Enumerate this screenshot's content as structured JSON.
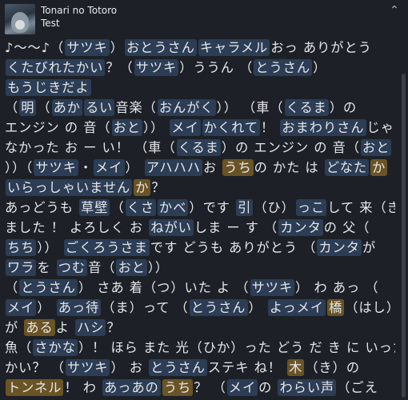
{
  "song": {
    "title": "Tonari no Totoro",
    "subtitle": "Test"
  },
  "icons": {
    "collapse": "chevron-up-icon"
  },
  "colors": {
    "word_highlight": "#2c3d55",
    "active_highlight": "#6a5425",
    "background": "#1d2127"
  },
  "lyrics": [
    [
      [
        "♪〜〜♪（",
        ""
      ],
      [
        "サツキ",
        "w"
      ],
      [
        "）",
        ""
      ],
      [
        "おとうさん",
        "w"
      ],
      [
        "キャラメル",
        "w"
      ],
      [
        "おっ ありがとう",
        ""
      ]
    ],
    [
      [
        "くたびれたかい",
        "w"
      ],
      [
        "？（",
        ""
      ],
      [
        "サツキ",
        "w"
      ],
      [
        "）ううん （",
        ""
      ],
      [
        "とうさん",
        "w"
      ],
      [
        "）",
        ""
      ]
    ],
    [
      [
        "もうじきだよ",
        "w"
      ]
    ],
    [
      [
        "（",
        ""
      ],
      [
        "明",
        "w"
      ],
      [
        "（",
        ""
      ],
      [
        "あか",
        "w"
      ],
      [
        "るい",
        "w"
      ],
      [
        "音楽（",
        ""
      ],
      [
        "おんがく",
        "w"
      ],
      [
        "）） （",
        ""
      ],
      [
        "車",
        ""
      ],
      [
        "（",
        ""
      ],
      [
        "くるま",
        "w"
      ],
      [
        "）の",
        ""
      ]
    ],
    [
      [
        "エンジン の 音（",
        ""
      ],
      [
        "おと",
        "w"
      ],
      [
        "）） ",
        ""
      ],
      [
        "メイ",
        "w"
      ],
      [
        "かくれて",
        "w"
      ],
      [
        "！ ",
        ""
      ],
      [
        "おまわりさん",
        "w"
      ],
      [
        "じゃ",
        ""
      ]
    ],
    [
      [
        "なかった お ー い！ （車（",
        ""
      ],
      [
        "くるま",
        "w"
      ],
      [
        "）の エンジン の 音（",
        ""
      ],
      [
        "おと",
        "w"
      ]
    ],
    [
      [
        "））（",
        ""
      ],
      [
        "サツキ",
        "w"
      ],
      [
        "・",
        ""
      ],
      [
        "メイ",
        "w"
      ],
      [
        "） ",
        ""
      ],
      [
        "アハハハ",
        "w"
      ],
      [
        "お ",
        ""
      ],
      [
        "うち",
        "y"
      ],
      [
        "の かた は ",
        ""
      ],
      [
        "どなた",
        "w"
      ],
      [
        "か",
        "y"
      ]
    ],
    [
      [
        "いらっしゃいません",
        "w"
      ],
      [
        "か",
        "y"
      ],
      [
        "？",
        ""
      ]
    ],
    [
      [
        "あっどうも ",
        ""
      ],
      [
        "草壁",
        "w"
      ],
      [
        "（",
        ""
      ],
      [
        "くさ",
        "w"
      ],
      [
        "かべ",
        "w"
      ],
      [
        "）です ",
        ""
      ],
      [
        "引",
        "w"
      ],
      [
        "（ひ）",
        ""
      ],
      [
        "っこ",
        "w"
      ],
      [
        "して 来（き）",
        ""
      ]
    ],
    [
      [
        "ました ！ よろしく お ",
        ""
      ],
      [
        "ねがい",
        "w"
      ],
      [
        "しま ー す （",
        ""
      ],
      [
        "カンタ",
        "w"
      ],
      [
        "の 父（",
        ""
      ]
    ],
    [
      [
        "ちち",
        "w"
      ],
      [
        "）） ",
        ""
      ],
      [
        "ごくろうさま",
        "w"
      ],
      [
        "です どうも ありがとう （",
        ""
      ],
      [
        "カンタ",
        "w"
      ],
      [
        "が",
        ""
      ]
    ],
    [
      [
        "ワラ",
        "w"
      ],
      [
        "を ",
        ""
      ],
      [
        "つむ",
        "w"
      ],
      [
        "音（",
        ""
      ],
      [
        "おと",
        "w"
      ],
      [
        "））",
        ""
      ]
    ],
    [
      [
        "（",
        ""
      ],
      [
        "とうさん",
        "w"
      ],
      [
        "） さあ 着（つ）いた よ （",
        ""
      ],
      [
        "サツキ",
        "w"
      ],
      [
        "） わ あっ （",
        ""
      ]
    ],
    [
      [
        "メイ",
        "w"
      ],
      [
        "） ",
        ""
      ],
      [
        "あっ待",
        "w"
      ],
      [
        "（ま）って （",
        ""
      ],
      [
        "とうさん",
        "w"
      ],
      [
        "） ",
        ""
      ],
      [
        "よっメイ",
        "w"
      ],
      [
        "橋",
        "y"
      ],
      [
        "（はし）",
        ""
      ]
    ],
    [
      [
        "が ",
        ""
      ],
      [
        "ある",
        "y"
      ],
      [
        "よ ",
        ""
      ],
      [
        "ハシ",
        "w"
      ],
      [
        "？",
        ""
      ]
    ],
    [
      [
        "魚（",
        ""
      ],
      [
        "さかな",
        "w"
      ],
      [
        "）！ ほら また 光（ひか）った どう だ き に いった",
        ""
      ]
    ],
    [
      [
        "かい？ （",
        ""
      ],
      [
        "サツキ",
        "w"
      ],
      [
        "） お ",
        ""
      ],
      [
        "とうさん",
        "w"
      ],
      [
        "ステキ ね！ ",
        ""
      ],
      [
        "木",
        "y"
      ],
      [
        "（き）の",
        ""
      ]
    ],
    [
      [
        "トンネル",
        "y"
      ],
      [
        "！ わ ",
        ""
      ],
      [
        "あっあの",
        "w"
      ],
      [
        "うち",
        "y"
      ],
      [
        "？ （",
        ""
      ],
      [
        "メイ",
        "w"
      ],
      [
        "の ",
        ""
      ],
      [
        "わらい声",
        "w"
      ],
      [
        "（ごえ",
        ""
      ]
    ],
    [
      [
        "））",
        ""
      ]
    ]
  ]
}
